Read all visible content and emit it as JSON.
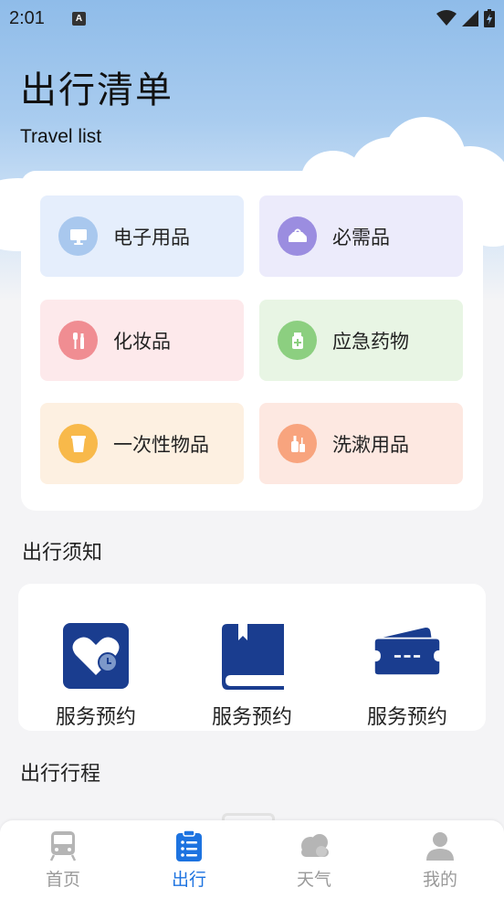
{
  "status_bar": {
    "time": "2:01",
    "notification_badge": "A"
  },
  "header": {
    "title": "出行清单",
    "subtitle": "Travel list"
  },
  "categories": [
    {
      "label": "电子用品",
      "icon": "monitor-icon",
      "bg": "#e5eefc",
      "icon_bg": "#a9c8ee"
    },
    {
      "label": "必需品",
      "icon": "tray-icon",
      "bg": "#ecebfb",
      "icon_bg": "#9b8de0"
    },
    {
      "label": "化妆品",
      "icon": "cosmetics-icon",
      "bg": "#fde9eb",
      "icon_bg": "#f08d92"
    },
    {
      "label": "应急药物",
      "icon": "medicine-icon",
      "bg": "#e8f5e4",
      "icon_bg": "#8ccf80"
    },
    {
      "label": "一次性物品",
      "icon": "cup-icon",
      "bg": "#fdf0e1",
      "icon_bg": "#f8b94a"
    },
    {
      "label": "洗漱用品",
      "icon": "toiletries-icon",
      "bg": "#fde8e1",
      "icon_bg": "#f8a47e"
    }
  ],
  "notice": {
    "title": "出行须知",
    "items": [
      {
        "label": "服务预约",
        "icon": "heart-icon"
      },
      {
        "label": "服务预约",
        "icon": "book-icon"
      },
      {
        "label": "服务预约",
        "icon": "ticket-icon"
      }
    ],
    "icon_color": "#1a3d8f"
  },
  "itinerary": {
    "title": "出行行程"
  },
  "tabs": [
    {
      "label": "首页",
      "icon": "train-icon",
      "active": false
    },
    {
      "label": "出行",
      "icon": "checklist-icon",
      "active": true
    },
    {
      "label": "天气",
      "icon": "cloud-icon",
      "active": false
    },
    {
      "label": "我的",
      "icon": "person-icon",
      "active": false
    }
  ],
  "colors": {
    "accent": "#1d73e0",
    "inactive": "#9a9a9a"
  }
}
